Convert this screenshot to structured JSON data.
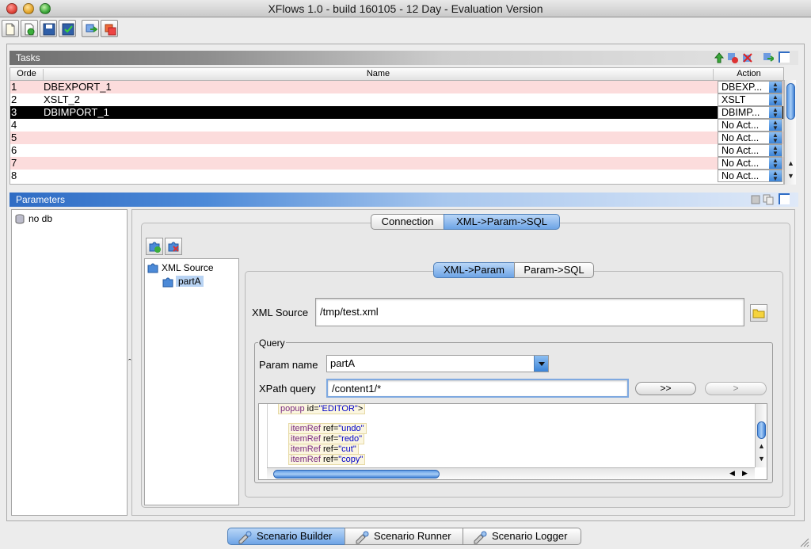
{
  "window": {
    "title": "XFlows 1.0 - build 160105 - 12 Day - Evaluation Version"
  },
  "tasks": {
    "header": "Tasks",
    "columns": {
      "order": "Orde",
      "name": "Name",
      "action": "Action"
    },
    "rows": [
      {
        "order": "1",
        "name": "DBEXPORT_1",
        "action": "DBEXP..."
      },
      {
        "order": "2",
        "name": "XSLT_2",
        "action": "XSLT"
      },
      {
        "order": "3",
        "name": "DBIMPORT_1",
        "action": "DBIMP..."
      },
      {
        "order": "4",
        "name": "",
        "action": "No Act..."
      },
      {
        "order": "5",
        "name": "",
        "action": "No Act..."
      },
      {
        "order": "6",
        "name": "",
        "action": "No Act..."
      },
      {
        "order": "7",
        "name": "",
        "action": "No Act..."
      },
      {
        "order": "8",
        "name": "",
        "action": "No Act..."
      }
    ]
  },
  "parameters": {
    "header": "Parameters",
    "db_tree_item": "no db",
    "collapse_glyph": "ˆ",
    "outer_tabs": {
      "connection": "Connection",
      "xml_param_sql": "XML->Param->SQL"
    },
    "source_tree": {
      "root": "XML Source",
      "child": "partA"
    },
    "inner_tabs": {
      "xml_param": "XML->Param",
      "param_sql": "Param->SQL"
    },
    "xml_source": {
      "label": "XML Source",
      "value": "/tmp/test.xml"
    },
    "query": {
      "legend": "Query",
      "param_name_label": "Param name",
      "param_name_value": "partA",
      "xpath_label": "XPath query",
      "xpath_value": "/content1/*",
      "btn_all": ">>",
      "btn_one": ">"
    },
    "xml_lines": [
      {
        "tag": "popup",
        "attr": "id",
        "val": "\"EDITOR\"",
        "close": ">"
      },
      {
        "tag": "itemRef",
        "attr": "ref",
        "val": "\"undo\"",
        "close": ""
      },
      {
        "tag": "itemRef",
        "attr": "ref",
        "val": "\"redo\"",
        "close": ""
      },
      {
        "tag": "itemRef",
        "attr": "ref",
        "val": "\"cut\"",
        "close": ""
      },
      {
        "tag": "itemRef",
        "attr": "ref",
        "val": "\"copy\"",
        "close": ""
      }
    ]
  },
  "bottom_tabs": {
    "builder": "Scenario Builder",
    "runner": "Scenario Runner",
    "logger": "Scenario Logger"
  },
  "colors": {
    "selection": "#000000",
    "pink_row": "#fcdcdc",
    "aqua_blue": "#6ea4e6"
  }
}
